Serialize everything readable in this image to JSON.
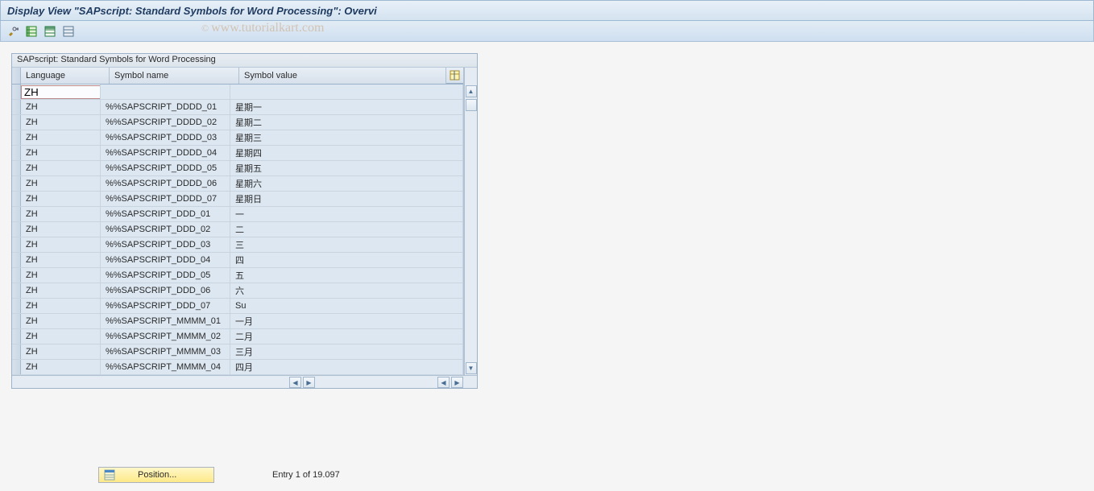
{
  "header": {
    "title": "Display View \"SAPscript: Standard Symbols for Word Processing\": Overvi"
  },
  "toolbar": {
    "buttons": [
      {
        "name": "toggle-edit",
        "color": "#b08820"
      },
      {
        "name": "select-all",
        "color": "#2a852a"
      },
      {
        "name": "deselect-all",
        "color": "#2a7c46"
      },
      {
        "name": "select-block",
        "color": "#5a7890"
      }
    ]
  },
  "panel": {
    "title": "SAPscript: Standard Symbols for Word Processing",
    "columns": {
      "language": "Language",
      "symbol_name": "Symbol name",
      "symbol_value": "Symbol value"
    },
    "first_row_input": "ZH",
    "rows": [
      {
        "language": "ZH",
        "name": "%%SAPSCRIPT_DDDD_01",
        "value": "星期一"
      },
      {
        "language": "ZH",
        "name": "%%SAPSCRIPT_DDDD_02",
        "value": "星期二"
      },
      {
        "language": "ZH",
        "name": "%%SAPSCRIPT_DDDD_03",
        "value": "星期三"
      },
      {
        "language": "ZH",
        "name": "%%SAPSCRIPT_DDDD_04",
        "value": "星期四"
      },
      {
        "language": "ZH",
        "name": "%%SAPSCRIPT_DDDD_05",
        "value": "星期五"
      },
      {
        "language": "ZH",
        "name": "%%SAPSCRIPT_DDDD_06",
        "value": "星期六"
      },
      {
        "language": "ZH",
        "name": "%%SAPSCRIPT_DDDD_07",
        "value": "星期日"
      },
      {
        "language": "ZH",
        "name": "%%SAPSCRIPT_DDD_01",
        "value": "一"
      },
      {
        "language": "ZH",
        "name": "%%SAPSCRIPT_DDD_02",
        "value": "二"
      },
      {
        "language": "ZH",
        "name": "%%SAPSCRIPT_DDD_03",
        "value": "三"
      },
      {
        "language": "ZH",
        "name": "%%SAPSCRIPT_DDD_04",
        "value": "四"
      },
      {
        "language": "ZH",
        "name": "%%SAPSCRIPT_DDD_05",
        "value": "五"
      },
      {
        "language": "ZH",
        "name": "%%SAPSCRIPT_DDD_06",
        "value": "六"
      },
      {
        "language": "ZH",
        "name": "%%SAPSCRIPT_DDD_07",
        "value": "Su"
      },
      {
        "language": "ZH",
        "name": "%%SAPSCRIPT_MMMM_01",
        "value": "一月"
      },
      {
        "language": "ZH",
        "name": "%%SAPSCRIPT_MMMM_02",
        "value": "二月"
      },
      {
        "language": "ZH",
        "name": "%%SAPSCRIPT_MMMM_03",
        "value": "三月"
      },
      {
        "language": "ZH",
        "name": "%%SAPSCRIPT_MMMM_04",
        "value": "四月"
      }
    ]
  },
  "footer": {
    "position_button": "Position...",
    "entry_text": "Entry 1 of 19.097"
  },
  "watermark": "www.tutorialkart.com"
}
